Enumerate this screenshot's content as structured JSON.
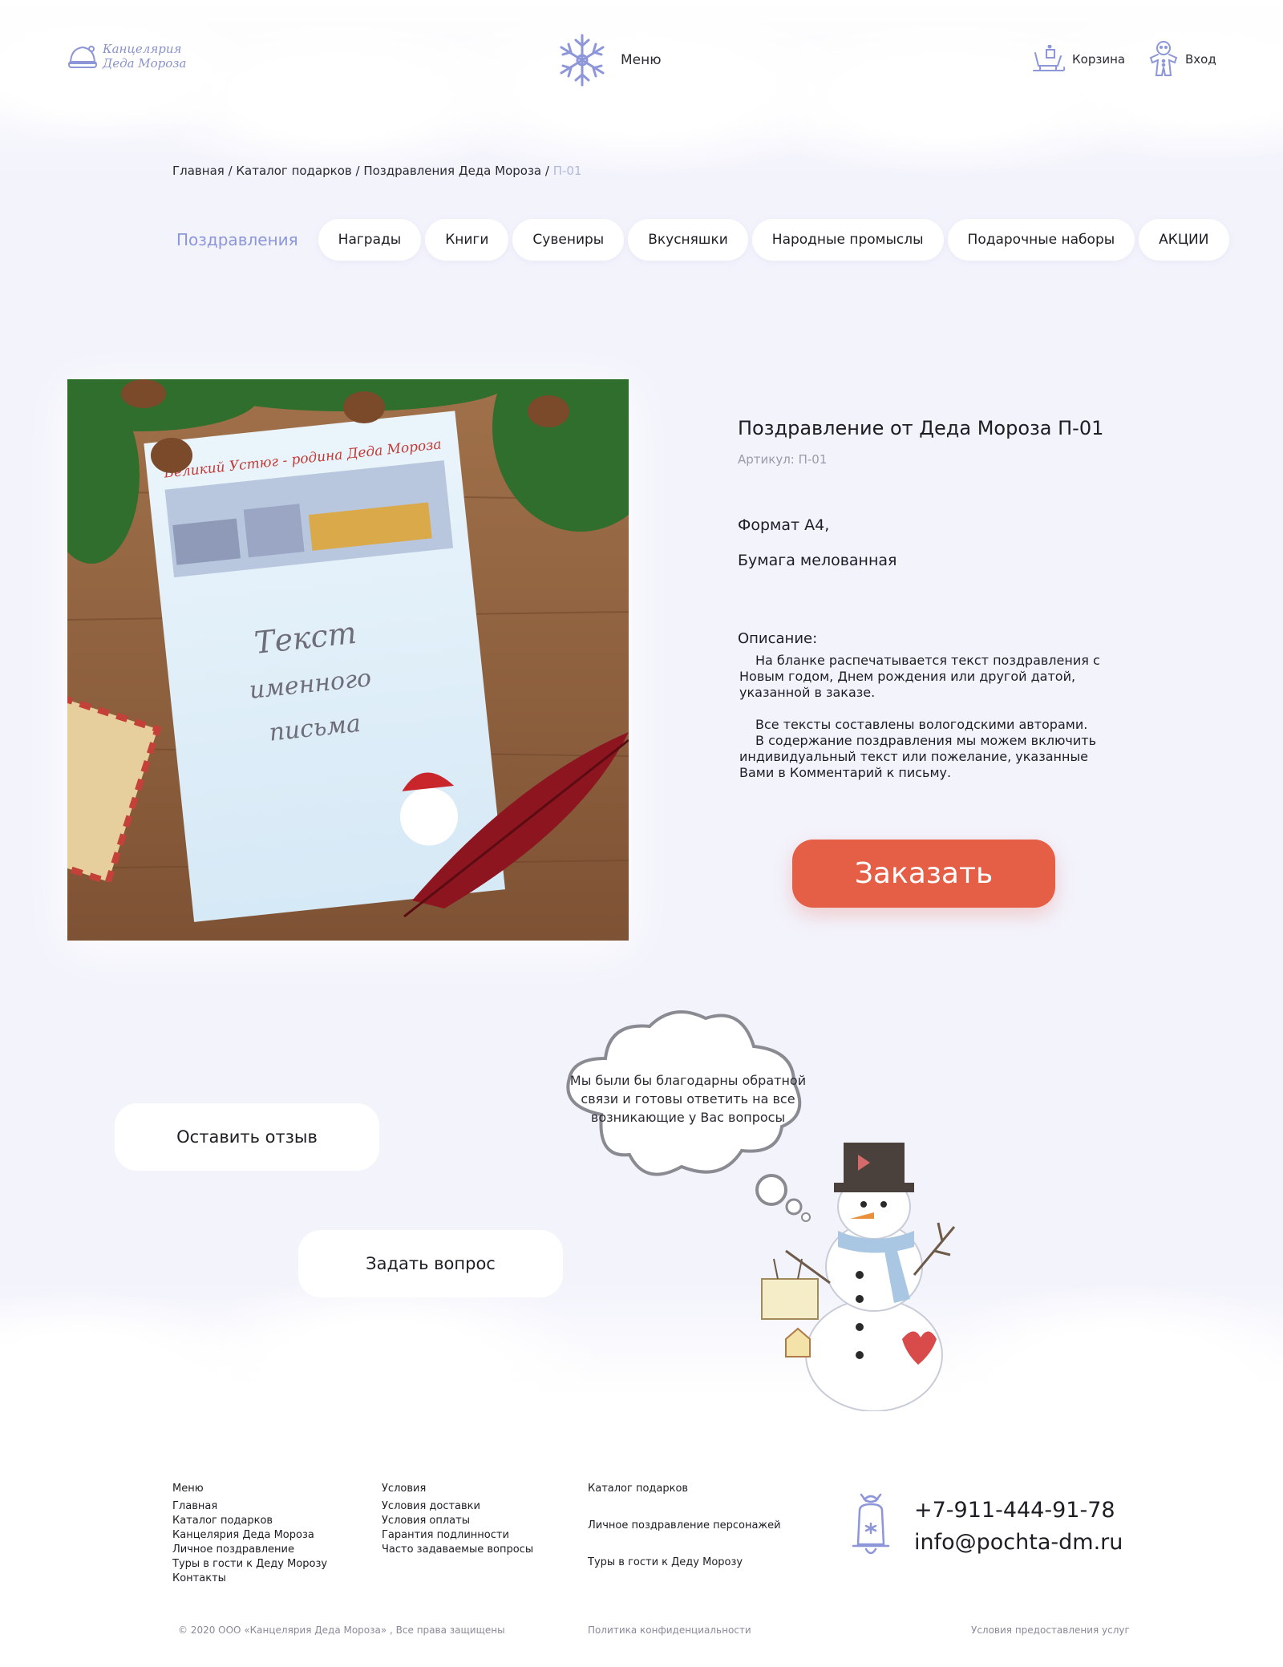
{
  "header": {
    "logo_text_line1": "Канцелярия",
    "logo_text_line2": "Деда Мороза",
    "menu_label": "Меню",
    "cart_label": "Корзина",
    "login_label": "Вход"
  },
  "breadcrumb": {
    "items": [
      "Главная",
      "Каталог подарков",
      "Поздравления Деда Мороза"
    ],
    "separator": " / ",
    "current": "П-01"
  },
  "tabs": [
    "Поздравления",
    "Награды",
    "Книги",
    "Сувениры",
    "Вкусняшки",
    "Народные промыслы",
    "Подарочные наборы",
    "АКЦИИ"
  ],
  "product": {
    "title": "Поздравление от Деда Мороза П-01",
    "sku": "Артикул: П-01",
    "spec1": "Формат А4,",
    "spec2": "Бумага мелованная",
    "desc_title": "Описание:",
    "desc_p1": "На бланке распечатывается текст поздравления с Новым годом, Днем рождения или другой датой, указанной в заказе.",
    "desc_p2": "Все тексты составлены вологодскими авторами.",
    "desc_p3": "В содержание поздравления мы можем включить индивидуальный текст или пожелание, указанные Вами в Комментарий к письму.",
    "order_label": "Заказать",
    "image": {
      "header_text": "Великий Устюг - родина Деда Мороза",
      "body_line1": "Текст",
      "body_line2": "именного",
      "body_line3": "письма"
    }
  },
  "feedback": {
    "review_label": "Оставить отзыв",
    "question_label": "Задать вопрос",
    "bubble_text": "Мы были бы благодарны обратной связи и готовы ответить на все возникающие у Вас вопросы"
  },
  "footer": {
    "col1": {
      "title": "Меню",
      "links": [
        "Главная",
        "Каталог подарков",
        "Канцелярия Деда Мороза",
        "Личное поздравление",
        "Туры в гости к Деду Морозу",
        "Контакты"
      ]
    },
    "col2": {
      "title": "Условия",
      "links": [
        "Условия доставки",
        "Условия оплаты",
        "Гарантия подлинности",
        "Часто задаваемые вопросы"
      ]
    },
    "col3": {
      "links": [
        "Каталог подарков",
        "Личное поздравление персонажей",
        "Туры в гости к Деду Морозу"
      ]
    },
    "phone": "+7-911-444-91-78",
    "email": "info@pochta-dm.ru",
    "copyright": "© 2020 ООО «Канцелярия Деда Мороза» , Все права защищены",
    "privacy": "Политика конфиденциальности",
    "terms": "Условия предоставления услуг"
  },
  "colors": {
    "accent": "#e55e46",
    "icon": "#8c96d8",
    "background": "#f3f3fc"
  }
}
